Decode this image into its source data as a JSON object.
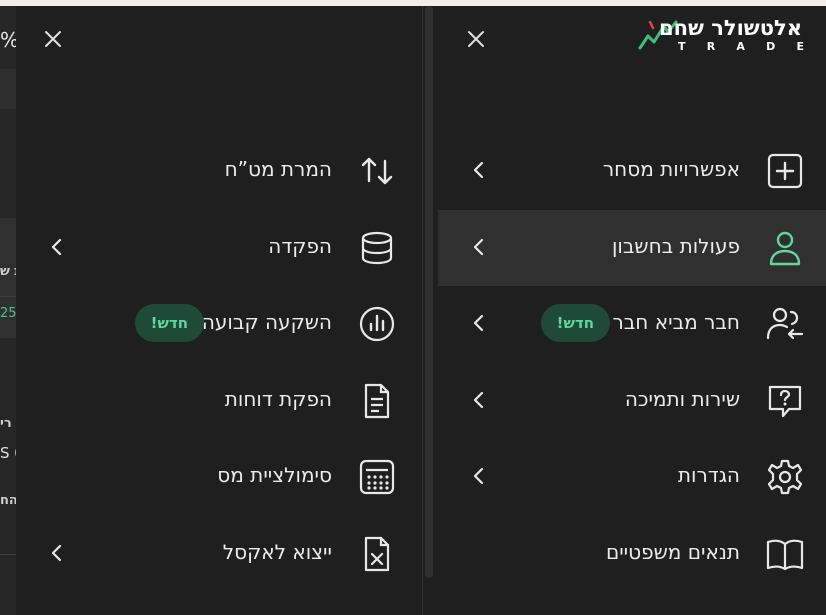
{
  "background_app": {
    "percent_fragment": "%",
    "text_fragment_1": "ת ש",
    "value_fragment": "25",
    "text_fragment_2": "רי",
    "value_fragment_2": "S 0",
    "text_fragment_3": "הח"
  },
  "brand": {
    "logo_text": "אלטשולר שחם",
    "logo_sub": [
      "T",
      "R",
      "A",
      "D",
      "E"
    ]
  },
  "left_menu": {
    "items": [
      {
        "label": "המרת מט”ח",
        "icon": "arrows-up-down-icon",
        "chevron": false
      },
      {
        "label": "הפקדה",
        "icon": "database-icon",
        "chevron": true
      },
      {
        "label": "השקעה קבועה",
        "icon": "chart-circle-icon",
        "chevron": false,
        "badge": "חדש!"
      },
      {
        "label": "הפקת דוחות",
        "icon": "document-icon",
        "chevron": false
      },
      {
        "label": "סימולציית מס",
        "icon": "calculator-icon",
        "chevron": false
      },
      {
        "label": "ייצוא לאקסל",
        "icon": "excel-file-icon",
        "chevron": true
      }
    ]
  },
  "right_menu": {
    "items": [
      {
        "label": "אפשרויות מסחר",
        "icon": "plus-square-icon",
        "chevron": true
      },
      {
        "label": "פעולות בחשבון",
        "icon": "user-icon",
        "chevron": true,
        "active": true
      },
      {
        "label": "חבר מביא חבר",
        "icon": "user-refer-icon",
        "chevron": true,
        "badge": "חדש!"
      },
      {
        "label": "שירות ותמיכה",
        "icon": "help-chat-icon",
        "chevron": true
      },
      {
        "label": "הגדרות",
        "icon": "gear-icon",
        "chevron": true
      },
      {
        "label": "תנאים משפטיים",
        "icon": "book-icon",
        "chevron": false
      }
    ]
  },
  "colors": {
    "accent_green": "#5fd79e",
    "badge_bg": "#1e4a37",
    "panel_bg": "#1f1f1f",
    "active_bg": "#303030"
  }
}
